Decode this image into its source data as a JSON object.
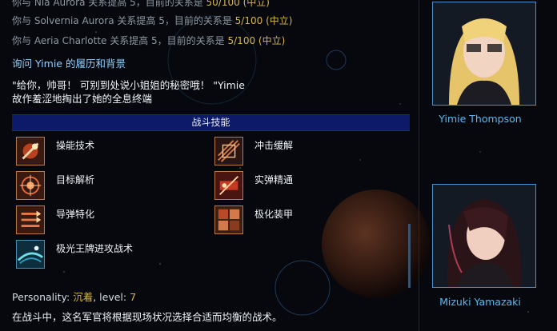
{
  "relations": [
    {
      "you_with": "你与",
      "name": "Nia Aurora",
      "text": " 关系提高 5，目前的关系是 ",
      "value": "50/100 (中立)"
    },
    {
      "you_with": "你与",
      "name": "Solvernia Aurora",
      "text": " 关系提高 5，目前的关系是 ",
      "value": "5/100 (中立)"
    },
    {
      "you_with": "你与",
      "name": "Aeria Charlotte",
      "text": " 关系提高 5，目前的关系是 ",
      "value": "5/100 (中立)"
    }
  ],
  "question": "询问 Yimie 的履历和背景",
  "quote_line1": "\"给你，帅哥！ 可别到处说小姐姐的秘密哦！ \"Yimie",
  "quote_line2": "故作羞涩地掏出了她的全息终端",
  "skills_header": "战斗技能",
  "skills": [
    {
      "name": "操能技术",
      "icon": "maneuver-icon"
    },
    {
      "name": "冲击缓解",
      "icon": "impact-icon"
    },
    {
      "name": "目标解析",
      "icon": "target-icon"
    },
    {
      "name": "实弹精通",
      "icon": "ballistic-icon"
    },
    {
      "name": "导弹特化",
      "icon": "missile-icon"
    },
    {
      "name": "极化装甲",
      "icon": "armor-icon"
    },
    {
      "name": "极光王牌进攻战术",
      "icon": "aurora-ace-icon"
    }
  ],
  "personality": {
    "label": "Personality: ",
    "value": "沉着",
    "level_label": ", level: ",
    "level": "7"
  },
  "description": "在战斗中，这名军官将根据现场状况选择合适而均衡的战术。",
  "officers": [
    {
      "name": "Yimie Thompson"
    },
    {
      "name": "Mizuki Yamazaki"
    }
  ],
  "colors": {
    "accent": "#58b9f4",
    "gold": "#d9b648",
    "header_bar": "#0d1a6a"
  }
}
